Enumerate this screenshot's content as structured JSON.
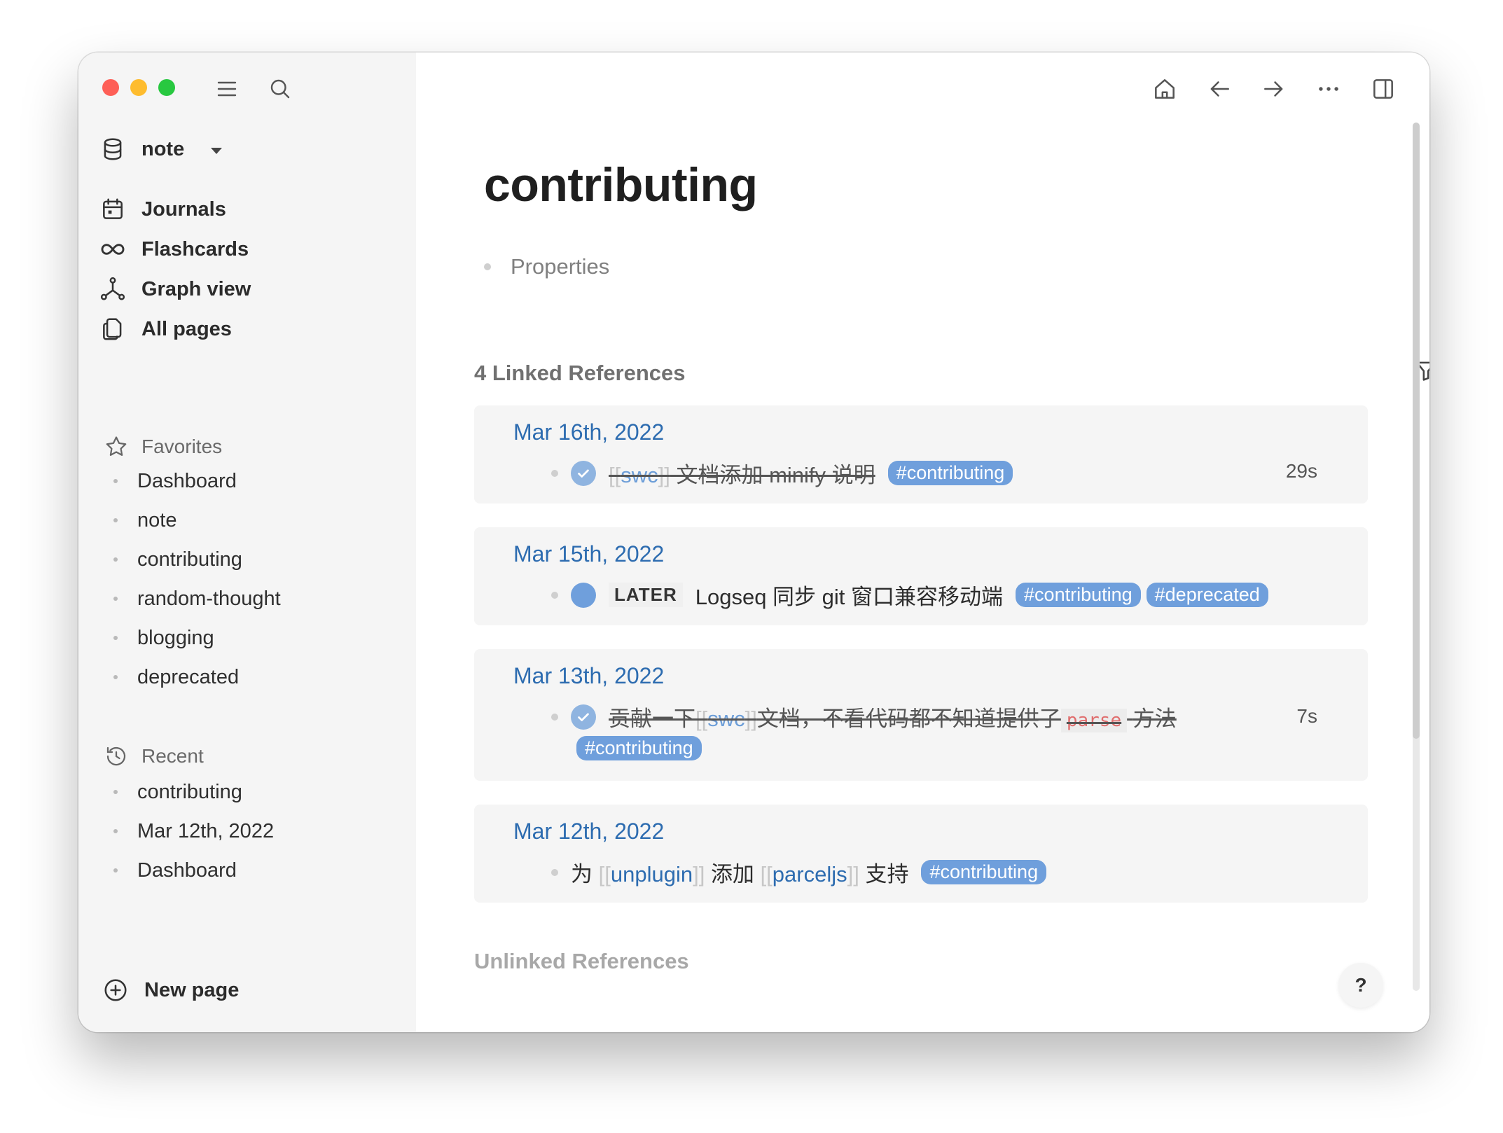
{
  "sidebar": {
    "graph": {
      "label": "note"
    },
    "nav": [
      {
        "label": "Journals",
        "icon": "calendar-icon"
      },
      {
        "label": "Flashcards",
        "icon": "infinity-icon"
      },
      {
        "label": "Graph view",
        "icon": "graph-icon"
      },
      {
        "label": "All pages",
        "icon": "pages-icon"
      }
    ],
    "favorites": {
      "title": "Favorites",
      "items": [
        "Dashboard",
        "note",
        "contributing",
        "random-thought",
        "blogging",
        "deprecated"
      ]
    },
    "recent": {
      "title": "Recent",
      "items": [
        "contributing",
        "Mar 12th, 2022",
        "Dashboard"
      ]
    },
    "new_page": "New page"
  },
  "page": {
    "title": "contributing",
    "properties_label": "Properties",
    "linked_title": "4 Linked References",
    "unlinked_title": "Unlinked References",
    "help": "?"
  },
  "refs": [
    {
      "date": "Mar 16th, 2022",
      "ref_open": "[[",
      "ref": "swc",
      "ref_close": "]]",
      "text": "文档添加 minify 说明",
      "tags": [
        "#contributing"
      ],
      "timer": "29s"
    },
    {
      "date": "Mar 15th, 2022",
      "marker": "LATER",
      "text": "Logseq 同步 git 窗口兼容移动端",
      "tags": [
        "#contributing",
        "#deprecated"
      ]
    },
    {
      "date": "Mar 13th, 2022",
      "text_a": "贡献一下",
      "ref_open": "[[",
      "ref": "swc",
      "ref_close": "]]",
      "text_b": "文档，不看代码都不知道提供了",
      "code": "parse",
      "text_c": "方法",
      "tags": [
        "#contributing"
      ],
      "timer": "7s"
    },
    {
      "date": "Mar 12th, 2022",
      "text_a": "为",
      "ref_open": "[[",
      "ref_a": "unplugin",
      "ref_close": "]]",
      "text_b": "添加",
      "ref_b": "parceljs",
      "text_c": "支持",
      "tags": [
        "#contributing"
      ]
    }
  ],
  "colors": {
    "link": "#2d6cb0",
    "tag_bg": "#6f9fdc",
    "sidebar_bg": "#f5f5f5",
    "card_bg": "#f5f5f5"
  }
}
